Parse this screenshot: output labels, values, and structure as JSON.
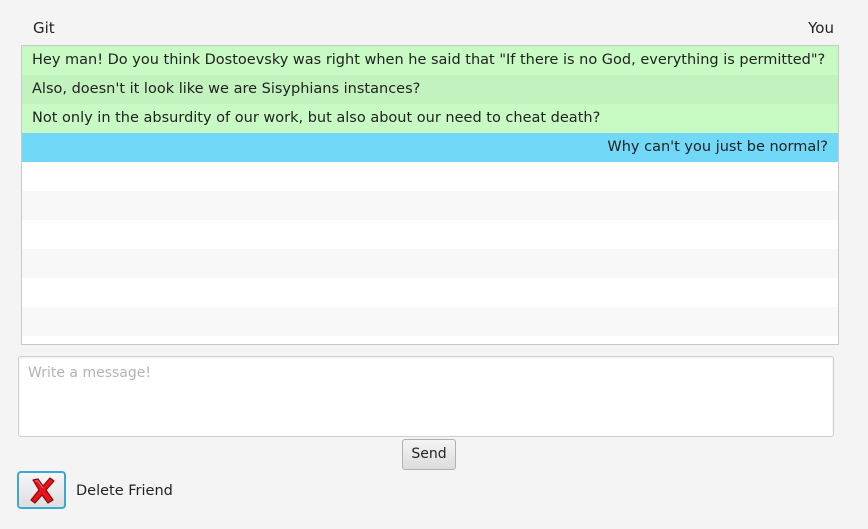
{
  "header": {
    "friend_name": "Git",
    "self_name": "You"
  },
  "chat": {
    "messages": [
      {
        "sender": "friend",
        "text": "Hey man! Do you think Dostoevsky was right when he said that \"If there is no God, everything is permitted\"?"
      },
      {
        "sender": "friend",
        "text": "Also, doesn't it look like we are Sisyphians instances?"
      },
      {
        "sender": "friend",
        "text": "Not only in the absurdity of our work, but also about our need to cheat death?"
      },
      {
        "sender": "self",
        "text": "Why can't you just be normal?"
      }
    ]
  },
  "composer": {
    "placeholder": "Write a message!",
    "value": ""
  },
  "actions": {
    "send_label": "Send",
    "delete_label": "Delete Friend"
  },
  "colors": {
    "friend_bubble": "#c8fbc3",
    "friend_bubble_alt": "#c2f2bd",
    "self_bubble": "#72d8f8",
    "delete_icon": "#e8131b",
    "focus_border": "#39a9d4"
  },
  "icons": {
    "delete": "red-x-icon"
  }
}
